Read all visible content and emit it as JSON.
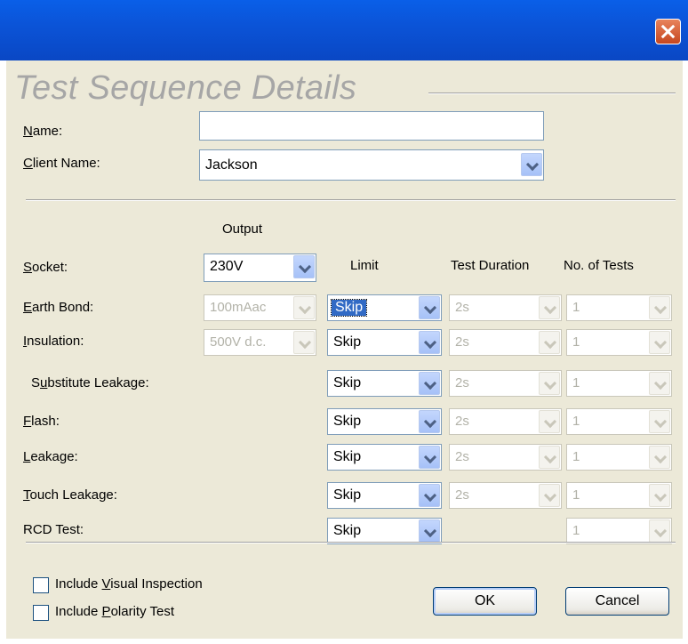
{
  "window": {
    "close_label": "Close"
  },
  "heading": "Test Sequence Details",
  "form": {
    "name": {
      "label_u": "N",
      "label_rest": "ame:",
      "value": ""
    },
    "client": {
      "label_u": "C",
      "label_rest": "lient Name:",
      "value": "Jackson"
    }
  },
  "columns": {
    "output": "Output",
    "limit": "Limit",
    "duration": "Test Duration",
    "tests": "No. of Tests"
  },
  "socket": {
    "label_u": "S",
    "label_rest": "ocket:",
    "value": "230V"
  },
  "rows": [
    {
      "label_pre": "",
      "label_u": "E",
      "label_rest": "arth Bond:",
      "output": "100mAac",
      "limit": "Skip",
      "duration": "2s",
      "tests": "1"
    },
    {
      "label_pre": "",
      "label_u": "I",
      "label_rest": "nsulation:",
      "output": "500V d.c.",
      "limit": "Skip",
      "duration": "2s",
      "tests": "1"
    },
    {
      "label_pre": "S",
      "label_u": "u",
      "label_rest": "bstitute Leakage:",
      "limit": "Skip",
      "duration": "2s",
      "tests": "1"
    },
    {
      "label_pre": "",
      "label_u": "F",
      "label_rest": "lash:",
      "limit": "Skip",
      "duration": "2s",
      "tests": "1"
    },
    {
      "label_pre": "",
      "label_u": "L",
      "label_rest": "eakage:",
      "limit": "Skip",
      "duration": "2s",
      "tests": "1"
    },
    {
      "label_pre": "",
      "label_u": "T",
      "label_rest": "ouch Leakage:",
      "limit": "Skip",
      "duration": "2s",
      "tests": "1"
    },
    {
      "label_pre": "",
      "label_u": "",
      "label_rest": "RCD Test:",
      "limit": "Skip",
      "tests": "1"
    }
  ],
  "checks": {
    "visual": {
      "pre": "Include ",
      "u": "V",
      "rest": "isual Inspection",
      "checked": false
    },
    "polarity": {
      "pre": "Include ",
      "u": "P",
      "rest": "olarity Test",
      "checked": false
    }
  },
  "buttons": {
    "ok": "OK",
    "cancel": "Cancel"
  }
}
